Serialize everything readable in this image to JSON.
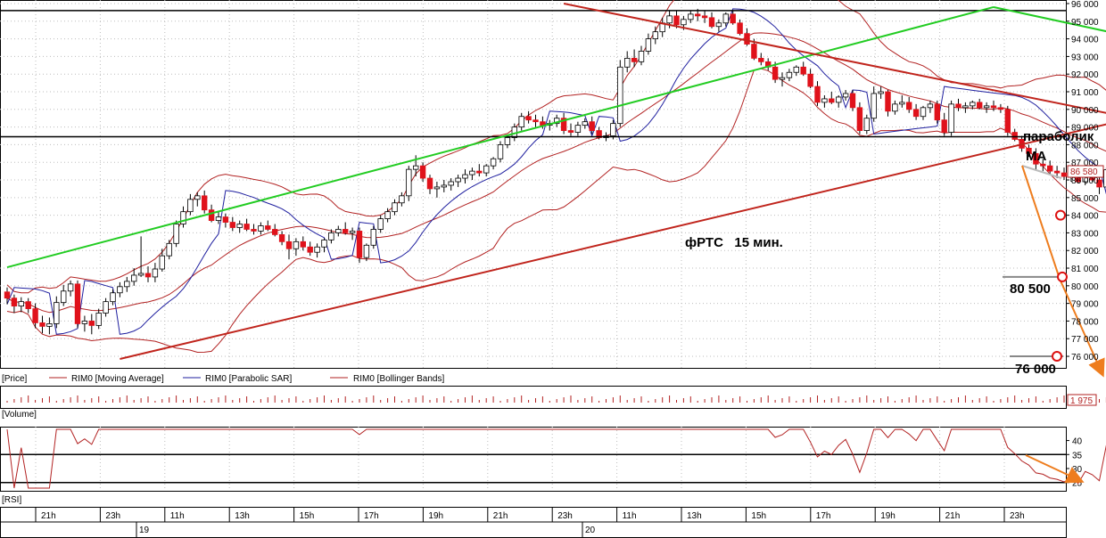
{
  "chart_data": {
    "type": "candlestick",
    "price_panel": {
      "title": "фРТС   15 мин.",
      "yticks": [
        "96 000",
        "95 000",
        "94 000",
        "93 000",
        "92 000",
        "91 000",
        "90 000",
        "89 000",
        "88 000",
        "87 000",
        "86 000",
        "85 000",
        "84 000",
        "83 000",
        "82 000",
        "81 000",
        "80 000",
        "79 000",
        "78 000",
        "77 000",
        "76 000"
      ],
      "ylim": [
        75800,
        96000
      ],
      "last_price": "86 580",
      "legend": {
        "price": "[Price]",
        "ma": "RIM0 [Moving Average]",
        "sar": "RIM0 [Parabolic SAR]",
        "bb": "RIM0 [Bollinger Bands]"
      },
      "annotations": {
        "parabolic": "параболик",
        "ma": "MA",
        "target1": "80 500",
        "target2": "76 000"
      },
      "horizontal_levels": [
        95600,
        88450
      ],
      "trend_lines": [
        {
          "color": "green",
          "from": [
            0,
            81050
          ],
          "to": [
            140,
            95800
          ]
        },
        {
          "color": "green",
          "from": [
            140,
            95800
          ],
          "to": [
            228,
            88250
          ]
        },
        {
          "color": "darkred",
          "from": [
            79,
            96000
          ],
          "to": [
            228,
            84000
          ]
        },
        {
          "color": "darkred",
          "from": [
            16,
            75850
          ],
          "to": [
            228,
            96000
          ]
        }
      ],
      "candles_ohlc": [
        [
          79650,
          79900,
          78950,
          79300
        ],
        [
          79300,
          79500,
          78450,
          78850
        ],
        [
          78850,
          79350,
          78500,
          79100
        ],
        [
          79100,
          79300,
          78450,
          78700
        ],
        [
          78700,
          79000,
          77600,
          77900
        ],
        [
          77900,
          78300,
          77300,
          77700
        ],
        [
          77700,
          78200,
          77250,
          77850
        ],
        [
          77850,
          79400,
          77600,
          79050
        ],
        [
          79050,
          80050,
          78850,
          79700
        ],
        [
          79700,
          80300,
          79400,
          80100
        ],
        [
          80100,
          80300,
          77600,
          77850
        ],
        [
          77850,
          78300,
          77400,
          78000
        ],
        [
          78000,
          78400,
          77250,
          77750
        ],
        [
          77750,
          78700,
          77550,
          78450
        ],
        [
          78450,
          79300,
          78250,
          79100
        ],
        [
          79100,
          79800,
          78900,
          79600
        ],
        [
          79600,
          80200,
          79350,
          79950
        ],
        [
          79950,
          80500,
          79650,
          80250
        ],
        [
          80250,
          81000,
          80000,
          80600
        ],
        [
          80600,
          82800,
          80500,
          80700
        ],
        [
          80700,
          81100,
          80200,
          80500
        ],
        [
          80500,
          81300,
          80200,
          80950
        ],
        [
          80950,
          82100,
          80800,
          81700
        ],
        [
          81700,
          82600,
          81500,
          82400
        ],
        [
          82400,
          83700,
          82200,
          83500
        ],
        [
          83500,
          84500,
          83300,
          84200
        ],
        [
          84200,
          85200,
          84000,
          84900
        ],
        [
          84900,
          85300,
          84500,
          85100
        ],
        [
          85100,
          85400,
          84100,
          84300
        ],
        [
          84300,
          84600,
          83600,
          83700
        ],
        [
          83700,
          84200,
          83500,
          83900
        ],
        [
          83900,
          84100,
          83300,
          83600
        ],
        [
          83600,
          83900,
          83100,
          83300
        ],
        [
          83300,
          83700,
          83000,
          83500
        ],
        [
          83500,
          83800,
          83100,
          83200
        ],
        [
          83200,
          83500,
          82900,
          83100
        ],
        [
          83100,
          83600,
          82900,
          83400
        ],
        [
          83400,
          83700,
          83100,
          83200
        ],
        [
          83200,
          83500,
          82800,
          82900
        ],
        [
          82900,
          83100,
          82300,
          82500
        ],
        [
          82500,
          82900,
          81500,
          82100
        ],
        [
          82100,
          82700,
          81700,
          82500
        ],
        [
          82500,
          82800,
          82000,
          82200
        ],
        [
          82200,
          82500,
          81700,
          81900
        ],
        [
          81900,
          82400,
          81600,
          82200
        ],
        [
          82200,
          82700,
          81900,
          82600
        ],
        [
          82600,
          83200,
          82400,
          83000
        ],
        [
          83000,
          83400,
          82800,
          83200
        ],
        [
          83200,
          83600,
          82900,
          83000
        ],
        [
          83000,
          83300,
          82600,
          83100
        ],
        [
          83100,
          83300,
          81300,
          81600
        ],
        [
          81600,
          82400,
          81400,
          82300
        ],
        [
          82300,
          83400,
          82100,
          83200
        ],
        [
          83200,
          84000,
          83000,
          83800
        ],
        [
          83800,
          84400,
          83600,
          84200
        ],
        [
          84200,
          84900,
          84000,
          84700
        ],
        [
          84700,
          85300,
          84500,
          85100
        ],
        [
          85100,
          86800,
          84800,
          86600
        ],
        [
          86600,
          87400,
          86200,
          86800
        ],
        [
          86800,
          87000,
          85900,
          86100
        ],
        [
          86100,
          86300,
          85200,
          85500
        ],
        [
          85500,
          85900,
          85000,
          85600
        ],
        [
          85600,
          86000,
          85300,
          85700
        ],
        [
          85700,
          86100,
          85400,
          85900
        ],
        [
          85900,
          86300,
          85600,
          86100
        ],
        [
          86100,
          86600,
          85800,
          86300
        ],
        [
          86300,
          86700,
          86000,
          86500
        ],
        [
          86500,
          86900,
          86200,
          86400
        ],
        [
          86400,
          86900,
          86200,
          86800
        ],
        [
          86800,
          87300,
          86600,
          87200
        ],
        [
          87200,
          88200,
          87000,
          88000
        ],
        [
          88000,
          88500,
          87800,
          88400
        ],
        [
          88400,
          89200,
          88200,
          89000
        ],
        [
          89000,
          89800,
          88800,
          89600
        ],
        [
          89600,
          89900,
          89200,
          89400
        ],
        [
          89400,
          89700,
          89000,
          89300
        ],
        [
          89300,
          89600,
          88900,
          89100
        ],
        [
          89100,
          89400,
          88800,
          89200
        ],
        [
          89200,
          89700,
          89000,
          89500
        ],
        [
          89500,
          89800,
          88600,
          88800
        ],
        [
          88800,
          89200,
          88500,
          88700
        ],
        [
          88700,
          89300,
          88500,
          89100
        ],
        [
          89100,
          89500,
          88900,
          89300
        ],
        [
          89300,
          89600,
          88600,
          88800
        ],
        [
          88800,
          89000,
          88300,
          88400
        ],
        [
          88400,
          88700,
          88200,
          88500
        ],
        [
          88500,
          89400,
          88300,
          89200
        ],
        [
          89200,
          92800,
          89000,
          92400
        ],
        [
          92400,
          93300,
          92100,
          92900
        ],
        [
          92900,
          93400,
          92400,
          92700
        ],
        [
          92700,
          93600,
          92500,
          93300
        ],
        [
          93300,
          94300,
          93100,
          94000
        ],
        [
          94000,
          94700,
          93700,
          94400
        ],
        [
          94400,
          95200,
          94100,
          94900
        ],
        [
          94900,
          95600,
          94600,
          95300
        ],
        [
          95300,
          95600,
          94600,
          94800
        ],
        [
          94800,
          95300,
          94500,
          95100
        ],
        [
          95100,
          95600,
          94900,
          95400
        ],
        [
          95400,
          95700,
          95000,
          95300
        ],
        [
          95300,
          95600,
          94900,
          95200
        ],
        [
          95200,
          95500,
          94600,
          94700
        ],
        [
          94700,
          95100,
          94400,
          94900
        ],
        [
          94900,
          95500,
          94700,
          95400
        ],
        [
          95400,
          95600,
          94800,
          94900
        ],
        [
          94900,
          95100,
          94200,
          94300
        ],
        [
          94300,
          94600,
          93600,
          93700
        ],
        [
          93700,
          94000,
          92800,
          92900
        ],
        [
          92900,
          93200,
          92500,
          92700
        ],
        [
          92700,
          92900,
          92200,
          92400
        ],
        [
          92400,
          92700,
          91500,
          91700
        ],
        [
          91700,
          92100,
          91300,
          91800
        ],
        [
          91800,
          92300,
          91600,
          92100
        ],
        [
          92100,
          92500,
          91900,
          92400
        ],
        [
          92400,
          92700,
          91900,
          92000
        ],
        [
          92000,
          92300,
          91200,
          91300
        ],
        [
          91300,
          91600,
          90200,
          90400
        ],
        [
          90400,
          90800,
          90100,
          90600
        ],
        [
          90600,
          91000,
          90300,
          90400
        ],
        [
          90400,
          90800,
          90100,
          90700
        ],
        [
          90700,
          91100,
          90500,
          90900
        ],
        [
          90900,
          91100,
          89900,
          90100
        ],
        [
          90100,
          90400,
          88600,
          88800
        ],
        [
          88800,
          89700,
          88600,
          89500
        ],
        [
          89500,
          91300,
          89300,
          90900
        ],
        [
          90900,
          91300,
          90600,
          91000
        ],
        [
          91000,
          91100,
          89600,
          89900
        ],
        [
          89900,
          90500,
          89700,
          90300
        ],
        [
          90300,
          90800,
          90100,
          90400
        ],
        [
          90400,
          90700,
          89800,
          90000
        ],
        [
          90000,
          90300,
          89400,
          89600
        ],
        [
          89600,
          90200,
          89400,
          90100
        ],
        [
          90100,
          90500,
          89800,
          90300
        ],
        [
          90300,
          90500,
          89200,
          89400
        ],
        [
          89400,
          89800,
          88500,
          88700
        ],
        [
          88700,
          90500,
          88500,
          90300
        ],
        [
          90300,
          90600,
          89900,
          90100
        ],
        [
          90100,
          90400,
          89800,
          90200
        ],
        [
          90200,
          90500,
          90000,
          90400
        ],
        [
          90400,
          90600,
          90000,
          90100
        ],
        [
          90100,
          90400,
          89800,
          90200
        ],
        [
          90200,
          90500,
          89900,
          90100
        ],
        [
          90100,
          90300,
          89800,
          90000
        ],
        [
          90000,
          90200,
          88500,
          88700
        ],
        [
          88700,
          88900,
          88200,
          88300
        ],
        [
          88300,
          88500,
          87600,
          87800
        ],
        [
          87800,
          88000,
          87300,
          87500
        ],
        [
          87500,
          87800,
          86600,
          86900
        ],
        [
          86900,
          87200,
          86500,
          86800
        ],
        [
          86800,
          87100,
          86300,
          86500
        ],
        [
          86500,
          86800,
          86100,
          86400
        ],
        [
          86400,
          86700,
          86000,
          86200
        ],
        [
          86200,
          86500,
          85900,
          86300
        ],
        [
          86300,
          86600,
          85800,
          85900
        ],
        [
          85900,
          86400,
          85700,
          86200
        ],
        [
          86200,
          86700,
          85900,
          86000
        ],
        [
          86000,
          86200,
          85200,
          85600
        ],
        [
          85600,
          86700,
          85400,
          86580
        ]
      ]
    },
    "volume_panel": {
      "label": "[Volume]",
      "last_value": "1 975"
    },
    "rsi_panel": {
      "label": "[RSI]",
      "yticks": [
        "40",
        "35",
        "30",
        "25"
      ],
      "ylim": [
        23,
        44
      ],
      "levels": [
        35,
        25
      ]
    },
    "time_axis": {
      "hour_labels": [
        "21h",
        "23h",
        "11h",
        "13h",
        "15h",
        "17h",
        "19h",
        "21h",
        "23h",
        "11h",
        "13h",
        "15h",
        "17h",
        "19h",
        "21h",
        "23h"
      ],
      "date_labels": [
        "19",
        "20"
      ]
    }
  },
  "colors": {
    "up": "#ffffff",
    "down": "#e0121b",
    "wick": "#000000",
    "ma": "#b22222",
    "bb": "#b22222",
    "sar": "#1f1f9f",
    "green_line": "#22cc22",
    "red_line": "#c0241c",
    "arrow": "#ee7d1e"
  }
}
